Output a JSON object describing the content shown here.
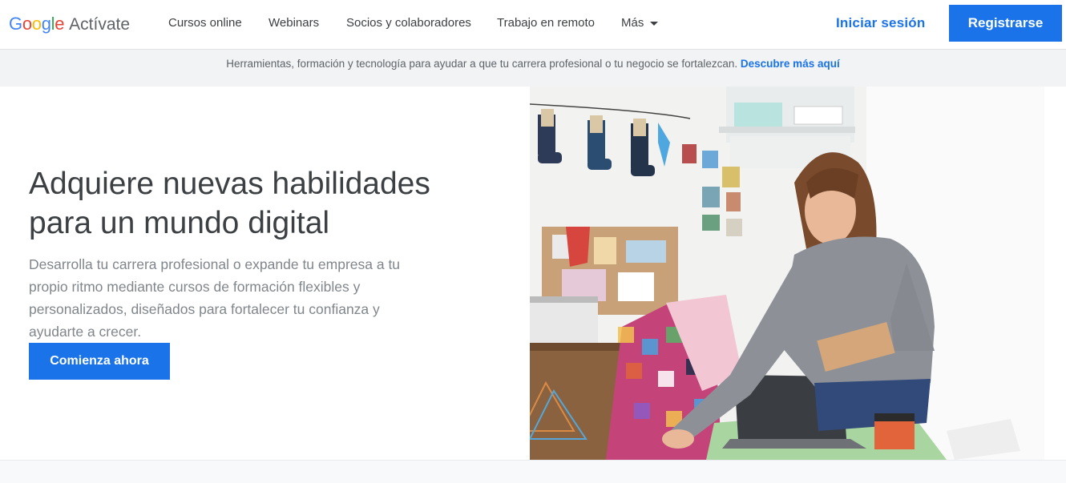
{
  "header": {
    "logo": {
      "google": [
        "G",
        "o",
        "o",
        "g",
        "l",
        "e"
      ],
      "product": "Actívate"
    },
    "nav": {
      "cursos": "Cursos online",
      "webinars": "Webinars",
      "socios": "Socios y colaboradores",
      "trabajo": "Trabajo en remoto",
      "mas": "Más"
    },
    "signin_label": "Iniciar sesión",
    "register_label": "Registrarse"
  },
  "banner": {
    "text": "Herramientas, formación y tecnología para ayudar a que tu carrera profesional o tu negocio se fortalezcan.",
    "link": "Descubre más aquí"
  },
  "hero": {
    "title_line1": "Adquiere nuevas habilidades",
    "title_line2": "para un mundo digital",
    "description": "Desarrolla tu carrera profesional o expande tu empresa a tu propio ritmo mediante cursos de formación flexibles y personalizados, diseñados para fortalecer tu confianza y ayudarte a crecer.",
    "cta_label": "Comienza ahora"
  },
  "colors": {
    "accent": "#1a73e8",
    "text_dark": "#3c4043",
    "text_muted": "#80868b",
    "banner_bg": "#f1f3f4"
  }
}
